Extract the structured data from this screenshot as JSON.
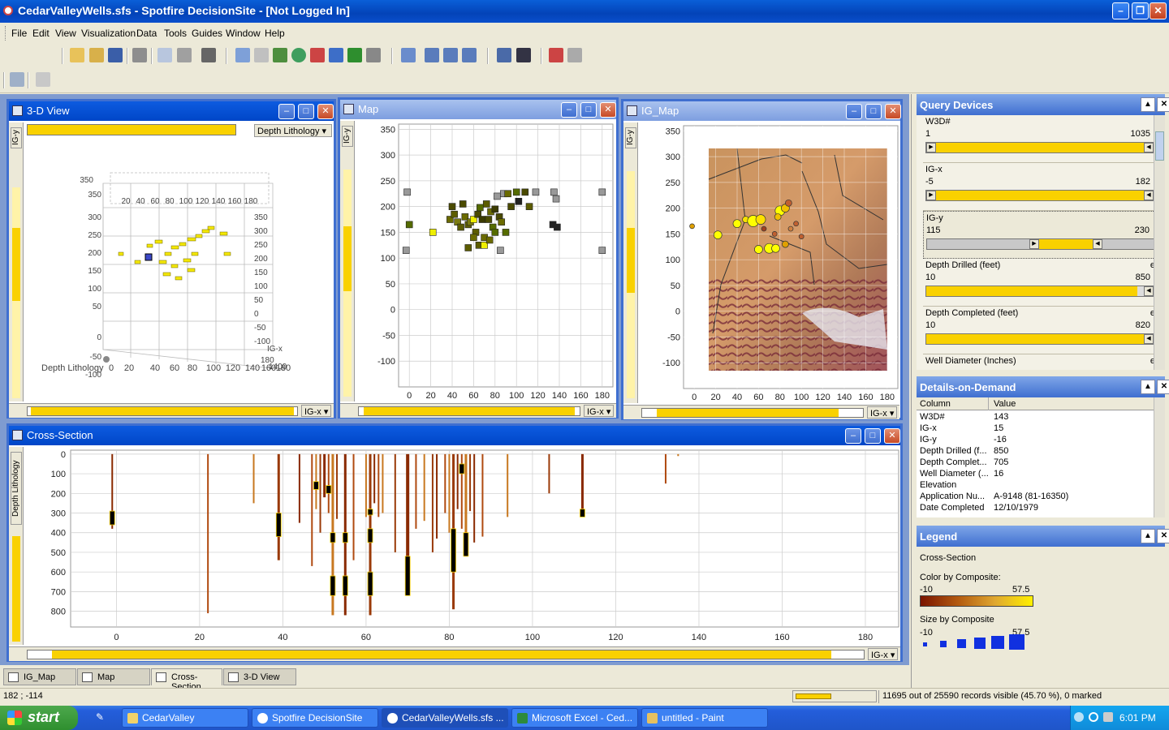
{
  "window": {
    "title": "CedarValleyWells.sfs - Spotfire DecisionSite - [Not Logged In]"
  },
  "menu": [
    "File",
    "Edit",
    "View",
    "Visualization",
    "Data",
    "Tools",
    "Guides",
    "Window",
    "Help"
  ],
  "views": {
    "view3d": {
      "title": "3-D View",
      "color_axis": "Depth Lithology",
      "x_axis": "IG-x",
      "y_axis": "IG-y",
      "depth_label": "Depth Lithology",
      "ticks_top": [
        "20",
        "40",
        "60",
        "80",
        "100",
        "120",
        "140",
        "160",
        "180"
      ],
      "ticks_left": [
        "350",
        "300",
        "250",
        "200",
        "150",
        "100",
        "50",
        "0",
        "-50",
        "-100"
      ],
      "ticks_right": [
        "350",
        "300",
        "250",
        "200",
        "150",
        "100",
        "50",
        "0",
        "-50",
        "-100"
      ],
      "ticks_bottom": [
        "0",
        "20",
        "40",
        "60",
        "80",
        "100",
        "120",
        "140",
        "160",
        "180"
      ],
      "corner_top": "350",
      "corner_right_a": "IG-x",
      "corner_right_b": "180",
      "corner_right_c": "1400"
    },
    "map": {
      "title": "Map",
      "x_axis": "IG-x",
      "y_axis": "IG-y",
      "xticks": [
        "0",
        "20",
        "40",
        "60",
        "80",
        "100",
        "120",
        "140",
        "160",
        "180"
      ],
      "yticks": [
        "350",
        "300",
        "250",
        "200",
        "150",
        "100",
        "50",
        "0",
        "-50",
        "-100"
      ]
    },
    "igmap": {
      "title": "IG_Map",
      "x_axis": "IG-x",
      "y_axis": "IG-y",
      "xticks": [
        "0",
        "20",
        "40",
        "60",
        "80",
        "100",
        "120",
        "140",
        "160",
        "180"
      ],
      "yticks": [
        "350",
        "300",
        "250",
        "200",
        "150",
        "100",
        "50",
        "0",
        "-50",
        "-100"
      ]
    },
    "cross": {
      "title": "Cross-Section",
      "x_axis": "IG-x",
      "y_axis": "Depth Lithology",
      "xticks": [
        "0",
        "20",
        "40",
        "60",
        "80",
        "100",
        "120",
        "140",
        "160",
        "180"
      ],
      "yticks": [
        "0",
        "100",
        "200",
        "300",
        "400",
        "500",
        "600",
        "700",
        "800"
      ]
    }
  },
  "query_devices": {
    "title": "Query Devices",
    "items": [
      {
        "name": "W3D#",
        "min": "1",
        "max": "1035",
        "e": "",
        "fill_from": 0.0,
        "fill_to": 1.0
      },
      {
        "name": "IG-x",
        "min": "-5",
        "max": "182",
        "e": "",
        "fill_from": 0.0,
        "fill_to": 1.0
      },
      {
        "name": "IG-y",
        "min": "115",
        "max": "230",
        "e": "",
        "fill_from": 0.48,
        "fill_to": 0.76
      },
      {
        "name": "Depth Drilled (feet)",
        "min": "10",
        "max": "850",
        "e": "e",
        "fill_from": 0.0,
        "fill_to": 1.0
      },
      {
        "name": "Depth Completed (feet)",
        "min": "10",
        "max": "820",
        "e": "e",
        "fill_from": 0.0,
        "fill_to": 1.0
      },
      {
        "name": "Well Diameter (Inches)",
        "min": "",
        "max": "",
        "e": "e",
        "fill_from": 0.0,
        "fill_to": 0.0
      }
    ]
  },
  "details": {
    "title": "Details-on-Demand",
    "col_header": "Column",
    "val_header": "Value",
    "rows": [
      {
        "c": "W3D#",
        "v": "143"
      },
      {
        "c": "IG-x",
        "v": "15"
      },
      {
        "c": "IG-y",
        "v": "-16"
      },
      {
        "c": "Depth Drilled (f...",
        "v": "850"
      },
      {
        "c": "Depth Complet...",
        "v": "705"
      },
      {
        "c": "Well Diameter (...",
        "v": "16"
      },
      {
        "c": "Elevation",
        "v": ""
      },
      {
        "c": "Application Nu...",
        "v": "A-9148 (81-16350)"
      },
      {
        "c": "Date Completed",
        "v": "12/10/1979"
      }
    ]
  },
  "legend": {
    "title": "Legend",
    "view": "Cross-Section",
    "color_label": "Color by Composite:",
    "color_min": "-10",
    "color_max": "57.5",
    "size_label": "Size by Composite",
    "size_min": "-10",
    "size_max": "57.5"
  },
  "tabs": [
    "IG_Map",
    "Map",
    "Cross-Section",
    "3-D View"
  ],
  "status": {
    "coords": "182 ; -114",
    "records": "11695 out of 25590 records visible (45.70 %), 0 marked"
  },
  "taskbar": {
    "start": "start",
    "tasks": [
      "CedarValley",
      "Spotfire DecisionSite",
      "CedarValleyWells.sfs ...",
      "Microsoft Excel - Ced...",
      "untitled - Paint"
    ],
    "clock": "6:01 PM"
  },
  "colors": {
    "xp_blue": "#0a5fd8",
    "selection_yellow": "#f9d100",
    "workspace": "#7f9bd0"
  }
}
